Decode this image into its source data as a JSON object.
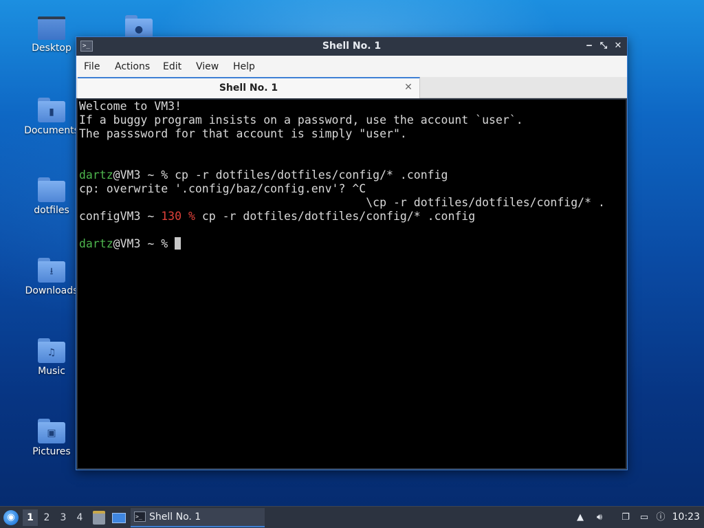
{
  "desktop": {
    "icons": [
      {
        "label": "Desktop",
        "icon": "desktop-icon"
      },
      {
        "label": "Documents",
        "icon": "folder-documents-icon"
      },
      {
        "label": "dotfiles",
        "icon": "folder-icon"
      },
      {
        "label": "Downloads",
        "icon": "folder-downloads-icon"
      },
      {
        "label": "Music",
        "icon": "folder-music-icon"
      },
      {
        "label": "Pictures",
        "icon": "folder-pictures-icon"
      }
    ]
  },
  "window": {
    "title": "Shell No. 1",
    "controls": {
      "minimize": "‒",
      "maximize": "⤡",
      "close": "✕"
    },
    "menu": [
      "File",
      "Actions",
      "Edit",
      "View",
      "Help"
    ],
    "tab": {
      "label": "Shell No. 1",
      "close": "✕"
    }
  },
  "terminal": {
    "lines": [
      {
        "text": "Welcome to VM3!"
      },
      {
        "text": "If a buggy program insists on a password, use the account `user`."
      },
      {
        "text": "The passsword for that account is simply \"user\"."
      },
      {
        "user": "dartz",
        "host_prompt": "@VM3 ~ % ",
        "cmd": "cp -r dotfiles/dotfiles/config/* .config"
      },
      {
        "text": "cp: overwrite '.config/baz/config.env'? ^C"
      },
      {
        "text": "                                          \\cp -r dotfiles/dotfiles/config/* ."
      },
      {
        "prefix": "configVM3 ~ ",
        "status": "130 %",
        "cmd": " cp -r dotfiles/dotfiles/config/* .config"
      },
      {
        "user": "dartz",
        "host_prompt": "@VM3 ~ % "
      }
    ]
  },
  "taskbar": {
    "workspaces": [
      "1",
      "2",
      "3",
      "4"
    ],
    "active_workspace": "1",
    "task_label": "Shell No. 1",
    "clock": "10:23"
  },
  "colors": {
    "prompt_user": "#4db54d",
    "exit_status": "#e0413a",
    "accent": "#3d7fd4"
  }
}
